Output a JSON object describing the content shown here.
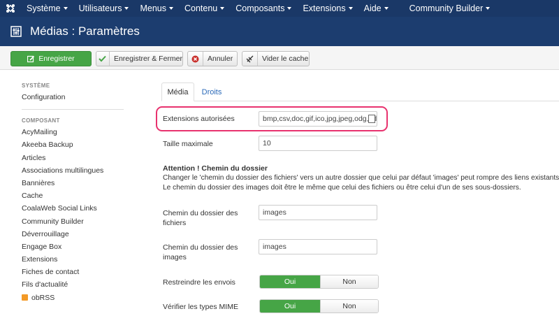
{
  "nav": {
    "items": [
      "Système",
      "Utilisateurs",
      "Menus",
      "Contenu",
      "Composants",
      "Extensions",
      "Aide"
    ],
    "community": "Community Builder"
  },
  "header": {
    "title": "Médias : Paramètres"
  },
  "toolbar": {
    "save_label": "Enregistrer",
    "save_close_label": "Enregistrer & Fermer",
    "cancel_label": "Annuler",
    "clear_cache_label": "Vider le cache",
    "save_color": "#46a546",
    "cancel_icon_color": "#c9302c"
  },
  "sidebar": {
    "system_heading": "SYSTÈME",
    "system_items": [
      "Configuration"
    ],
    "component_heading": "COMPOSANT",
    "component_items": [
      "AcyMailing",
      "Akeeba Backup",
      "Articles",
      "Associations multilingues",
      "Bannières",
      "Cache",
      "CoalaWeb Social Links",
      "Community Builder",
      "Déverrouillage",
      "Engage Box",
      "Extensions",
      "Fiches de contact",
      "Fils d'actualité",
      "obRSS"
    ]
  },
  "tabs": {
    "media": "Média",
    "rights": "Droits"
  },
  "form": {
    "extensions_label": "Extensions autorisées",
    "extensions_value": "bmp,csv,doc,gif,ico,jpg,jpeg,odg,odp,ods,odt,pdf,png,ppt,swf,txt,xcf,xls,BMP,CSV,DOC,GIF,ICO,JPG,JPEG,ODG,ODP,ODS,ODT,PDF,PNG,PPT,SWF,TXT,XCF,XLS",
    "max_size_label": "Taille maximale",
    "max_size_value": "10",
    "warning_title": "Attention ! Chemin du dossier",
    "warning_line1": "Changer le 'chemin du dossier des fichiers' vers un autre dossier que celui par défaut 'images' peut rompre des liens existants.",
    "warning_line2": "Le chemin du dossier des images doit être le même que celui des fichiers ou être celui d'un de ses sous-dossiers.",
    "file_path_label_1": "Chemin du dossier des",
    "file_path_label_2": "fichiers",
    "file_path_value": "images",
    "image_path_label_1": "Chemin du dossier des",
    "image_path_label_2": "images",
    "image_path_value": "images",
    "restrict_label": "Restreindre les envois",
    "mime_label": "Vérifier les types MIME",
    "yes": "Oui",
    "no": "Non",
    "highlight_color": "#e8326e"
  }
}
